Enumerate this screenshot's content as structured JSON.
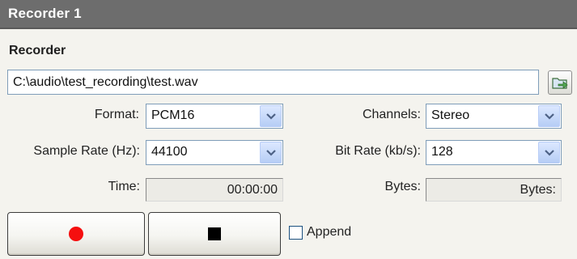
{
  "window": {
    "title": "Recorder 1"
  },
  "group": {
    "label": "Recorder"
  },
  "file": {
    "path": "C:\\audio\\test_recording\\test.wav"
  },
  "format": {
    "label": "Format:",
    "value": "PCM16"
  },
  "channels": {
    "label": "Channels:",
    "value": "Stereo"
  },
  "sample_rate": {
    "label": "Sample Rate (Hz):",
    "value": "44100"
  },
  "bit_rate": {
    "label": "Bit Rate (kb/s):",
    "value": "128"
  },
  "time": {
    "label": "Time:",
    "value": "00:00:00"
  },
  "bytes": {
    "label": "Bytes:",
    "value": "Bytes:"
  },
  "append": {
    "label": "Append",
    "checked": false
  },
  "controls": {
    "record_icon": "record-icon",
    "stop_icon": "stop-icon",
    "record_color": "#f50f0f"
  },
  "colors": {
    "titlebar": "#6d6d6d",
    "panel": "#f4f3ee",
    "input_border": "#7f9db9"
  }
}
